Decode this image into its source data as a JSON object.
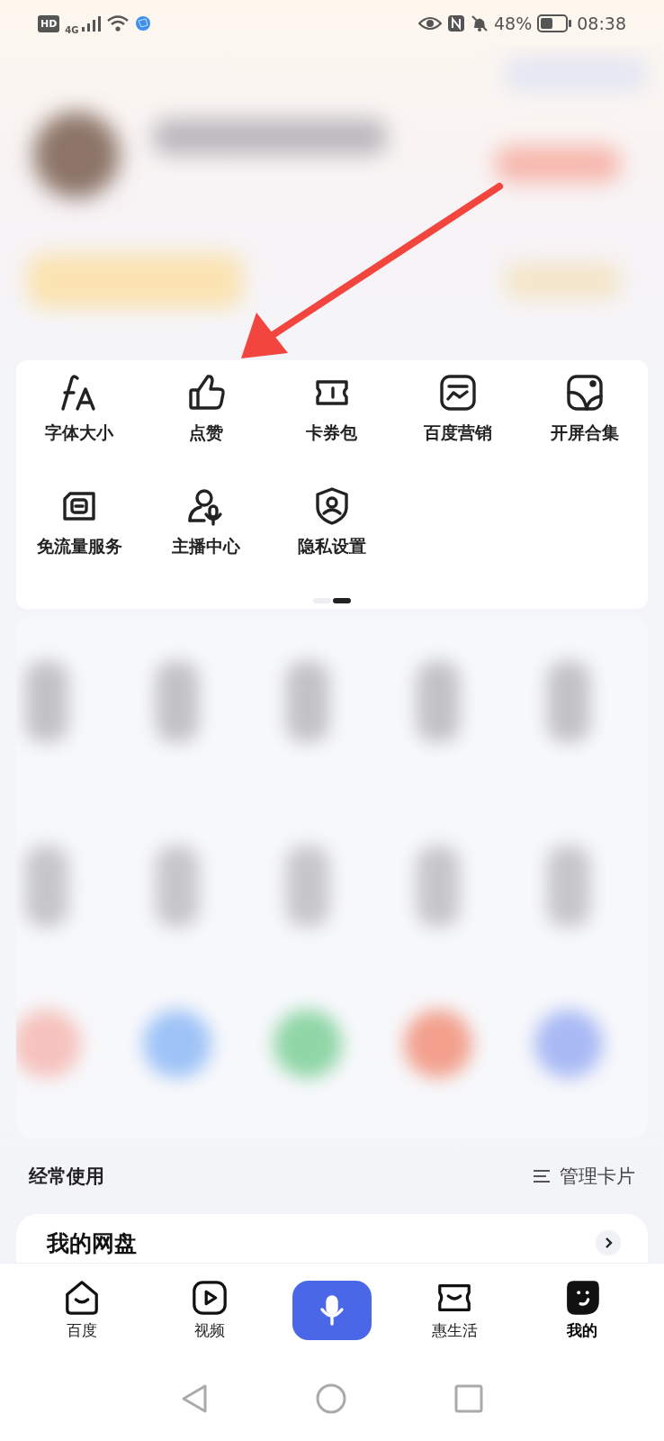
{
  "status_bar": {
    "hd": "HD",
    "network": "4G",
    "battery": "48%",
    "time": "08:38"
  },
  "tools": [
    {
      "label": "字体大小"
    },
    {
      "label": "点赞"
    },
    {
      "label": "卡券包"
    },
    {
      "label": "百度营销"
    },
    {
      "label": "开屏合集"
    },
    {
      "label": "免流量服务"
    },
    {
      "label": "主播中心"
    },
    {
      "label": "隐私设置"
    }
  ],
  "pager": [
    {
      "selected": false
    },
    {
      "selected": true
    }
  ],
  "section": {
    "title": "经常使用",
    "action": "管理卡片"
  },
  "card": {
    "title": "我的网盘"
  },
  "tab_bar": [
    {
      "kind": "tab",
      "label": "百度",
      "selected": false
    },
    {
      "kind": "tab",
      "label": "视频",
      "selected": false
    },
    {
      "kind": "voice",
      "selected": false
    },
    {
      "kind": "tab",
      "label": "惠生活",
      "selected": false
    },
    {
      "kind": "tab",
      "label": "我的",
      "selected": true
    }
  ]
}
